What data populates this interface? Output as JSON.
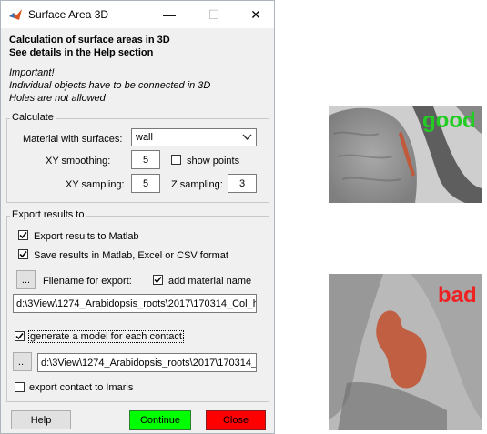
{
  "window": {
    "title": "Surface Area 3D"
  },
  "header": {
    "line1": "Calculation of surface areas in 3D",
    "line2": "See details in the Help section",
    "note1": "Important!",
    "note2": "Individual objects have to be connected in 3D",
    "note3": "Holes are not allowed"
  },
  "calculate": {
    "legend": "Calculate",
    "material_label": "Material with surfaces:",
    "material_value": "wall",
    "xy_smoothing_label": "XY smoothing:",
    "xy_smoothing_value": "5",
    "show_points_label": "show points",
    "show_points_checked": false,
    "xy_sampling_label": "XY sampling:",
    "xy_sampling_value": "5",
    "z_sampling_label": "Z sampling:",
    "z_sampling_value": "3"
  },
  "export": {
    "legend": "Export results to",
    "to_matlab_label": "Export results to Matlab",
    "to_matlab_checked": true,
    "save_results_label": "Save results in Matlab, Excel or CSV format",
    "save_results_checked": true,
    "browse_label": "...",
    "filename_label": "Filename for export:",
    "add_material_label": "add material name",
    "add_material_checked": true,
    "filename_value": "d:\\3View\\1274_Arabidopsis_roots\\2017\\170314_Col_h",
    "model_label": "generate a model for each contact",
    "model_checked": true,
    "model_browse_label": "...",
    "model_path_value": "d:\\3View\\1274_Arabidopsis_roots\\2017\\170314_",
    "imaris_label": "export contact to Imaris",
    "imaris_checked": false
  },
  "buttons": {
    "help": "Help",
    "continue": "Continue",
    "close": "Close"
  },
  "examples": {
    "good_label": "good",
    "bad_label": "bad",
    "good_color": "#22cc22",
    "bad_color": "#ee2222",
    "highlight_color": "#c05a3a"
  },
  "colors": {
    "continue_bg": "#00ff00",
    "close_bg": "#ff0000"
  }
}
